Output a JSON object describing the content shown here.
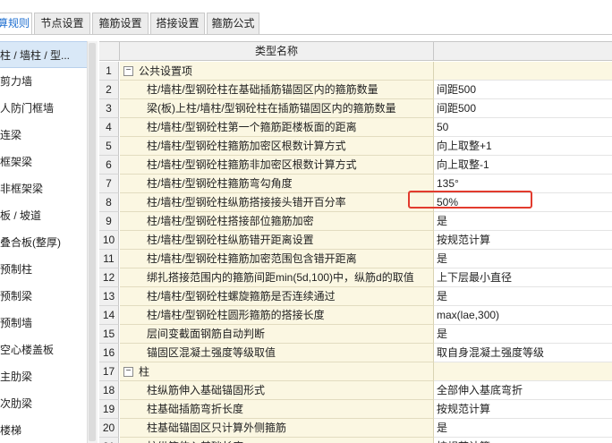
{
  "tabs": [
    "算规则",
    "节点设置",
    "箍筋设置",
    "搭接设置",
    "箍筋公式"
  ],
  "active_tab": 0,
  "left_items": [
    "柱 / 墙柱 / 型...",
    "剪力墙",
    "人防门框墙",
    "连梁",
    "框架梁",
    "非框架梁",
    "板 / 坡道",
    "叠合板(整厚)",
    "预制柱",
    "预制梁",
    "预制墙",
    "空心楼盖板",
    "主肋梁",
    "次肋梁",
    "楼梯"
  ],
  "grid": {
    "header": "类型名称",
    "rows": [
      {
        "num": "1",
        "name": "公共设置项",
        "value": "",
        "group": true
      },
      {
        "num": "2",
        "name": "柱/墙柱/型钢砼柱在基础插筋锚固区内的箍筋数量",
        "value": "间距500"
      },
      {
        "num": "3",
        "name": "梁(板)上柱/墙柱/型钢砼柱在插筋锚固区内的箍筋数量",
        "value": "间距500"
      },
      {
        "num": "4",
        "name": "柱/墙柱/型钢砼柱第一个箍筋距楼板面的距离",
        "value": "50"
      },
      {
        "num": "5",
        "name": "柱/墙柱/型钢砼柱箍筋加密区根数计算方式",
        "value": "向上取整+1"
      },
      {
        "num": "6",
        "name": "柱/墙柱/型钢砼柱箍筋非加密区根数计算方式",
        "value": "向上取整-1"
      },
      {
        "num": "7",
        "name": "柱/墙柱/型钢砼柱箍筋弯勾角度",
        "value": "135°"
      },
      {
        "num": "8",
        "name": "柱/墙柱/型钢砼柱纵筋搭接接头错开百分率",
        "value": "50%"
      },
      {
        "num": "9",
        "name": "柱/墙柱/型钢砼柱搭接部位箍筋加密",
        "value": "是"
      },
      {
        "num": "10",
        "name": "柱/墙柱/型钢砼柱纵筋错开距离设置",
        "value": "按规范计算"
      },
      {
        "num": "11",
        "name": "柱/墙柱/型钢砼柱箍筋加密范围包含错开距离",
        "value": "是"
      },
      {
        "num": "12",
        "name": "绑扎搭接范围内的箍筋间距min(5d,100)中，纵筋d的取值",
        "value": "上下层最小直径"
      },
      {
        "num": "13",
        "name": "柱/墙柱/型钢砼柱螺旋箍筋是否连续通过",
        "value": "是"
      },
      {
        "num": "14",
        "name": "柱/墙柱/型钢砼柱圆形箍筋的搭接长度",
        "value": "max(lae,300)"
      },
      {
        "num": "15",
        "name": "层间变截面钢筋自动判断",
        "value": "是"
      },
      {
        "num": "16",
        "name": "锚固区混凝土强度等级取值",
        "value": "取自身混凝土强度等级"
      },
      {
        "num": "17",
        "name": "柱",
        "value": "",
        "group": true
      },
      {
        "num": "18",
        "name": "柱纵筋伸入基础锚固形式",
        "value": "全部伸入基底弯折"
      },
      {
        "num": "19",
        "name": "柱基础插筋弯折长度",
        "value": "按规范计算"
      },
      {
        "num": "20",
        "name": "柱基础锚固区只计算外侧箍筋",
        "value": "是"
      },
      {
        "num": "21",
        "name": "柱纵筋伸入基础长度",
        "value": "按规范计算"
      }
    ]
  },
  "icons": {
    "expander": "collapse-minus-icon"
  },
  "colors": {
    "highlight_box": "#e23b2e",
    "name_cell_bg": "#fbf7e2",
    "active_tab_text": "#1f6fd0"
  }
}
